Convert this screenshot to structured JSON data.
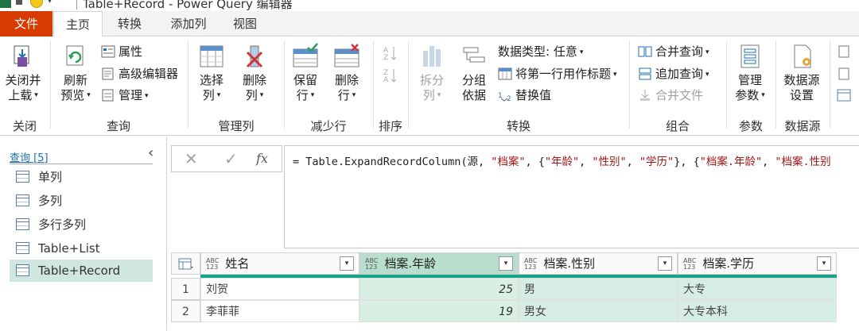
{
  "window": {
    "title": "Table+Record - Power Query 编辑器"
  },
  "tabs": {
    "file": "文件",
    "home": "主页",
    "transform": "转换",
    "add_column": "添加列",
    "view": "视图"
  },
  "ribbon": {
    "close": {
      "btn": "关闭并\n上载",
      "label": "关闭"
    },
    "query": {
      "refresh": "刷新\n预览",
      "properties": "属性",
      "advanced_editor": "高级编辑器",
      "manage": "管理",
      "label": "查询"
    },
    "manage_columns": {
      "choose": "选择\n列",
      "remove": "删除\n列",
      "label": "管理列"
    },
    "reduce_rows": {
      "keep": "保留\n行",
      "remove": "删除\n行",
      "label": "减少行"
    },
    "sort": {
      "label": "排序"
    },
    "transform": {
      "split": "拆分\n列",
      "group_by": "分组\n依据",
      "data_type": "数据类型: 任意",
      "first_row_header": "将第一行用作标题",
      "replace_values": "替换值",
      "label": "转换"
    },
    "combine": {
      "merge": "合并查询",
      "append": "追加查询",
      "combine_files": "合并文件",
      "label": "组合"
    },
    "parameters": {
      "manage": "管理\n参数",
      "label": "参数"
    },
    "data_sources": {
      "settings": "数据源\n设置",
      "label": "数据源"
    }
  },
  "queries_pane": {
    "header": "查询 [5]",
    "items": [
      "单列",
      "多列",
      "多行多列",
      "Table+List",
      "Table+Record"
    ],
    "selected": "Table+Record"
  },
  "formula_bar": {
    "cancel": "✕",
    "commit": "✓",
    "fx": "fx",
    "prefix": "= Table.ExpandRecordColumn(源, ",
    "s1": "\"档案\"",
    "mid1": ", {",
    "s2": "\"年龄\"",
    "c1": ", ",
    "s3": "\"性别\"",
    "c2": ", ",
    "s4": "\"学历\"",
    "mid2": "}, {",
    "s5": "\"档案.年龄\"",
    "c3": ", ",
    "s6": "\"档案.性别"
  },
  "grid": {
    "type_label": "ABC\n123",
    "columns": [
      "姓名",
      "档案.年龄",
      "档案.性别",
      "档案.学历"
    ],
    "rows": [
      {
        "n": "1",
        "name": "刘贺",
        "age": "25",
        "gender": "男",
        "edu": "大专"
      },
      {
        "n": "2",
        "name": "李菲菲",
        "age": "19",
        "gender": "男女",
        "edu": "大专本科"
      }
    ]
  },
  "colors": {
    "file_tab": "#d83b01",
    "accent": "#17a589",
    "selected_query": "#cfe7de",
    "highlight_col": "#b8dfcd"
  }
}
